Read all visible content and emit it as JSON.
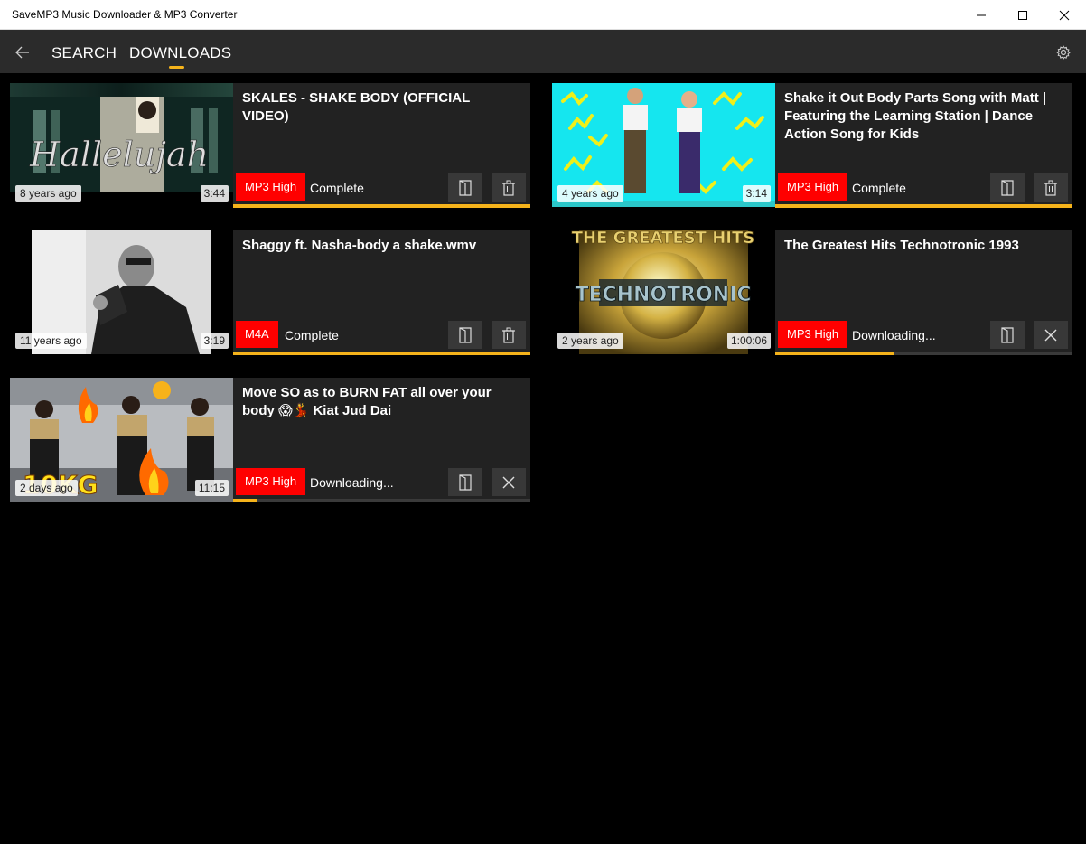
{
  "window": {
    "title": "SaveMP3 Music Downloader & MP3 Converter"
  },
  "nav": {
    "search": "SEARCH",
    "downloads": "DOWNLOADS"
  },
  "colors": {
    "accent": "#f5b31b",
    "format_badge": "#ff0000"
  },
  "downloads": [
    {
      "title": "SKALES - SHAKE BODY (OFFICIAL VIDEO)",
      "age": "8 years ago",
      "duration": "3:44",
      "format": "MP3 High",
      "status": "Complete",
      "progress": 1.0,
      "action_icon": "delete-icon",
      "thumb": "Hallelujah"
    },
    {
      "title": "Shake it Out Body Parts Song with Matt | Featuring the Learning Station | Dance Action Song for Kids",
      "age": "4 years ago",
      "duration": "3:14",
      "format": "MP3 High",
      "status": "Complete",
      "progress": 1.0,
      "action_icon": "delete-icon"
    },
    {
      "title": "Shaggy ft. Nasha-body a shake.wmv",
      "age": "11 years ago",
      "duration": "3:19",
      "format": "M4A",
      "status": "Complete",
      "progress": 1.0,
      "action_icon": "delete-icon"
    },
    {
      "title": "The Greatest Hits Technotronic 1993",
      "age": "2 years ago",
      "duration": "1:00:06",
      "format": "MP3 High",
      "status": "Downloading...",
      "progress": 0.4,
      "action_icon": "close-icon",
      "thumb": "TECHNOTRONIC"
    },
    {
      "title": "Move SO as to BURN FAT all over your body 😱💃 Kiat Jud Dai",
      "age": "2 days ago",
      "duration": "11:15",
      "format": "MP3 High",
      "status": "Downloading...",
      "progress": 0.08,
      "action_icon": "close-icon",
      "thumb": "10KG"
    }
  ]
}
